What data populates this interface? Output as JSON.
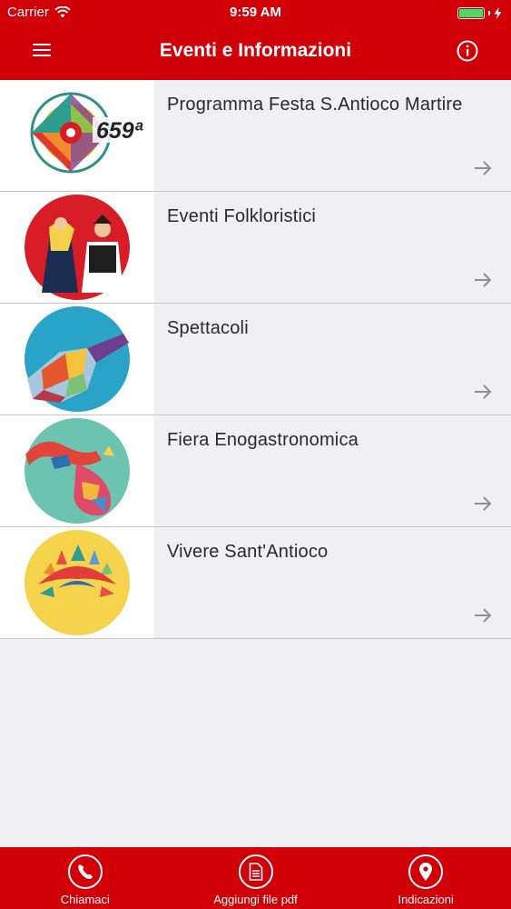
{
  "status_bar": {
    "carrier": "Carrier",
    "time": "9:59 AM"
  },
  "nav": {
    "title": "Eventi e Informazioni",
    "menu_icon": "hamburger-menu-icon",
    "info_icon": "info-icon"
  },
  "items": [
    {
      "title": "Programma Festa S.Antioco Martire",
      "badge": "659ª"
    },
    {
      "title": "Eventi Folkloristici"
    },
    {
      "title": "Spettacoli"
    },
    {
      "title": "Fiera Enogastronomica"
    },
    {
      "title": "Vivere Sant'Antioco"
    }
  ],
  "tabs": [
    {
      "label": "Chiamaci",
      "icon": "phone-icon"
    },
    {
      "label": "Aggiungi file pdf",
      "icon": "document-icon"
    },
    {
      "label": "Indicazioni",
      "icon": "map-pin-icon"
    }
  ],
  "colors": {
    "brand_red": "#d10008",
    "list_bg": "#efeff4",
    "battery_green": "#4cd964"
  }
}
